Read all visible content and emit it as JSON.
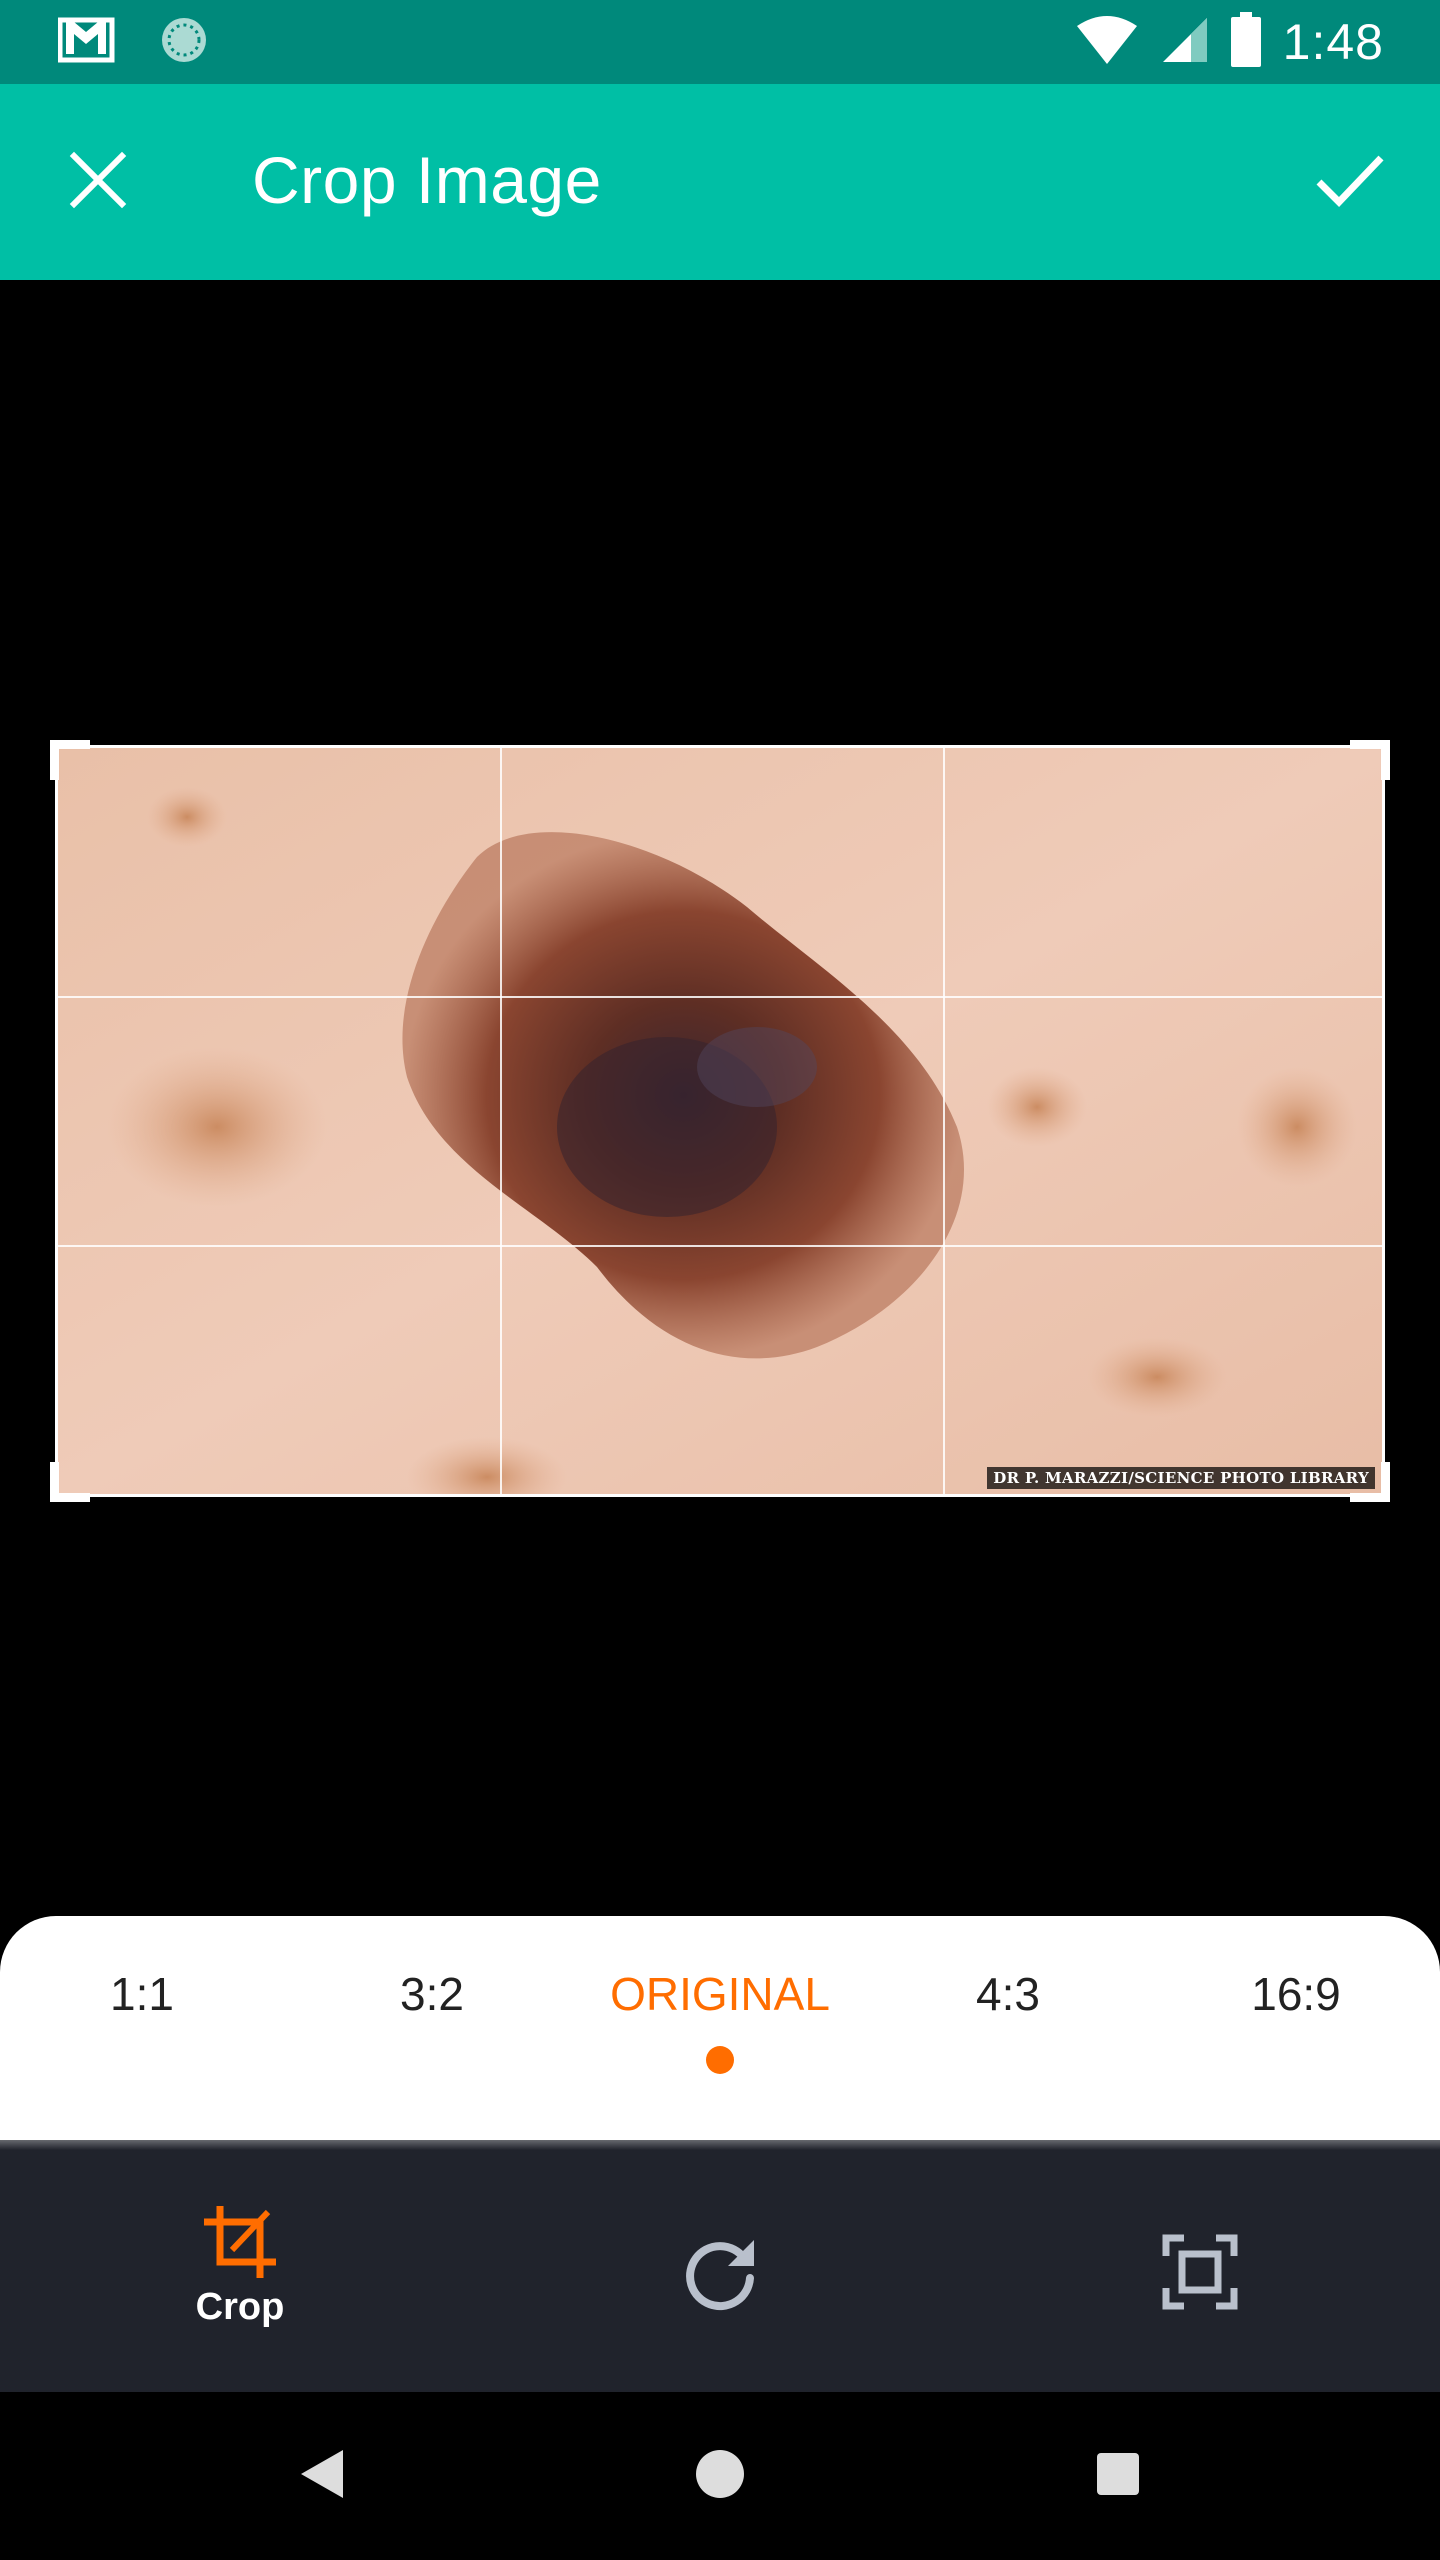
{
  "status_bar": {
    "time": "1:48",
    "left_icons": [
      "gmail-icon",
      "sync-icon"
    ],
    "right_icons": [
      "wifi-icon",
      "cell-signal-icon",
      "battery-icon"
    ]
  },
  "app_bar": {
    "title": "Crop Image",
    "close_icon": "close-icon",
    "confirm_icon": "check-icon",
    "background": "#00bfa5"
  },
  "image": {
    "credit": "DR P. MARAZZI/SCIENCE PHOTO LIBRARY"
  },
  "aspect_ratios": {
    "items": [
      {
        "label": "1:1",
        "active": false
      },
      {
        "label": "3:2",
        "active": false
      },
      {
        "label": "ORIGINAL",
        "active": true
      },
      {
        "label": "4:3",
        "active": false
      },
      {
        "label": "16:9",
        "active": false
      }
    ],
    "active_color": "#ff6d00"
  },
  "tools": {
    "crop": {
      "label": "Crop",
      "icon": "crop-icon",
      "active": true
    },
    "rotate": {
      "icon": "rotate-icon"
    },
    "fit": {
      "icon": "fit-screen-icon"
    }
  },
  "nav": {
    "back_icon": "back-icon",
    "home_icon": "home-icon",
    "recents_icon": "recents-icon"
  }
}
